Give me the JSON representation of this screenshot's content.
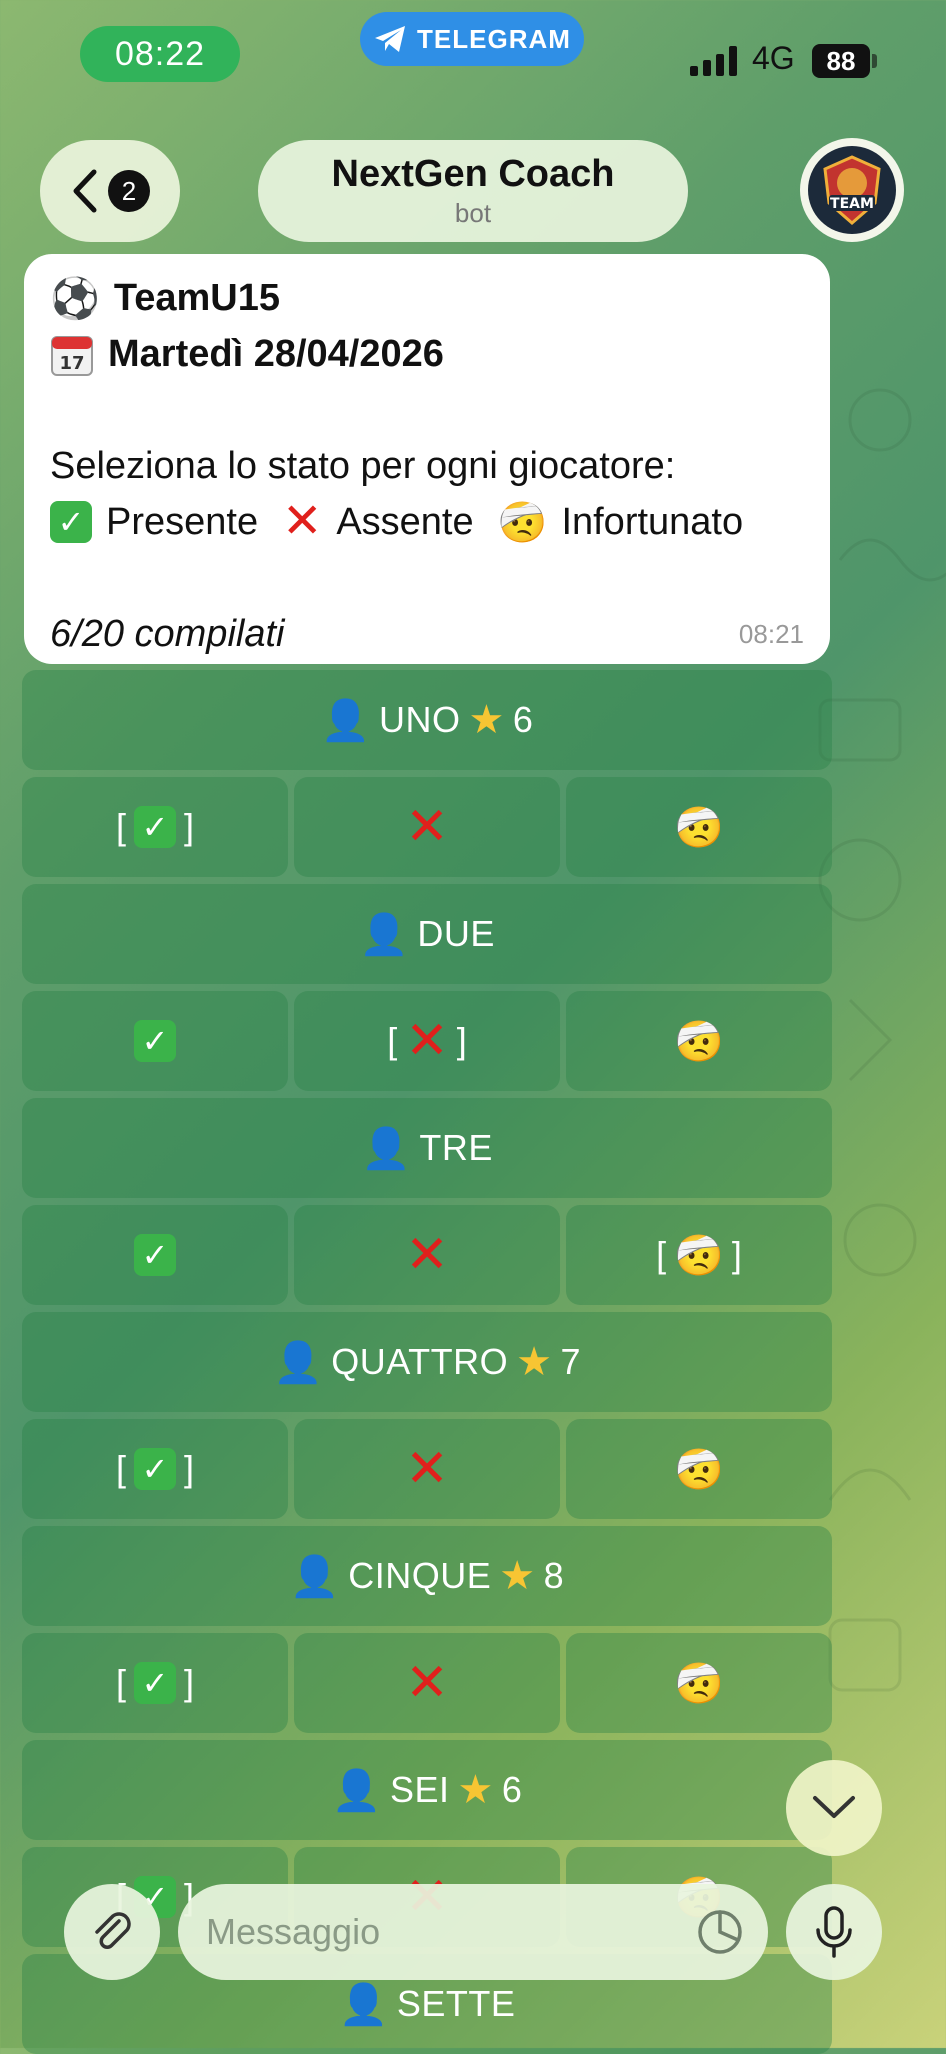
{
  "status_bar": {
    "time": "08:22",
    "app_pill": "TELEGRAM",
    "network": "4G",
    "battery": "88"
  },
  "header": {
    "back_badge": "2",
    "title": "NextGen Coach",
    "subtitle": "bot",
    "avatar_text": "TEAM"
  },
  "message": {
    "team": "TeamU15",
    "date": "Martedì 28/04/2026",
    "instruction": "Seleziona lo stato per ogni giocatore:",
    "legend": {
      "present": "Presente",
      "absent": "Assente",
      "injured": "Infortunato"
    },
    "progress": "6/20 compilati",
    "time": "08:21"
  },
  "players": [
    {
      "name": "UNO",
      "rating": "6",
      "selected": "present"
    },
    {
      "name": "DUE",
      "rating": "",
      "selected": "absent"
    },
    {
      "name": "TRE",
      "rating": "",
      "selected": "injured"
    },
    {
      "name": "QUATTRO",
      "rating": "7",
      "selected": "present"
    },
    {
      "name": "CINQUE",
      "rating": "8",
      "selected": "present"
    },
    {
      "name": "SEI",
      "rating": "6",
      "selected": "present"
    },
    {
      "name": "SETTE",
      "rating": "",
      "selected": ""
    }
  ],
  "input": {
    "placeholder": "Messaggio"
  }
}
